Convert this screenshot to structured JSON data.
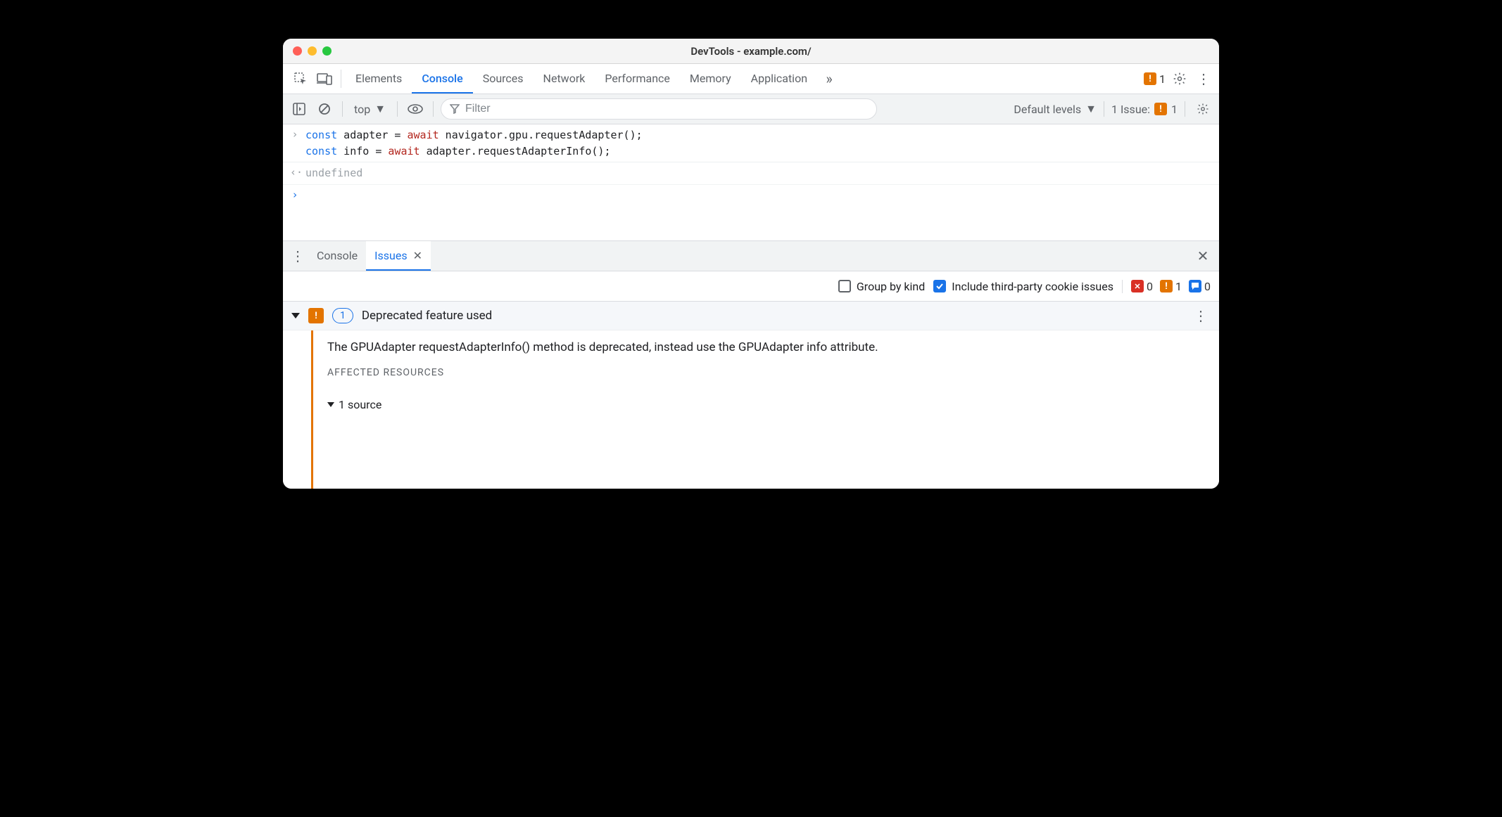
{
  "titlebar": {
    "title": "DevTools - example.com/"
  },
  "main_tabs": {
    "items": [
      "Elements",
      "Console",
      "Sources",
      "Network",
      "Performance",
      "Memory",
      "Application"
    ],
    "warning_count": "1"
  },
  "console_toolbar": {
    "context": "top",
    "filter_placeholder": "Filter",
    "levels": "Default levels",
    "issue_label": "1 Issue:",
    "issue_count": "1"
  },
  "console": {
    "code_line1_a": "const",
    "code_line1_b": " adapter = ",
    "code_line1_c": "await",
    "code_line1_d": " navigator.gpu.requestAdapter();",
    "code_line2_a": "const",
    "code_line2_b": " info = ",
    "code_line2_c": "await",
    "code_line2_d": " adapter.requestAdapterInfo();",
    "output": "undefined"
  },
  "drawer_tabs": {
    "console": "Console",
    "issues": "Issues"
  },
  "issues_controls": {
    "group_by_kind": "Group by kind",
    "include_third_party": "Include third-party cookie issues",
    "errors": "0",
    "warnings": "1",
    "info": "0"
  },
  "issue": {
    "count": "1",
    "title": "Deprecated feature used",
    "message": "The GPUAdapter requestAdapterInfo() method is deprecated, instead use the GPUAdapter info attribute.",
    "affected_label": "AFFECTED RESOURCES",
    "source_count": "1 source"
  }
}
